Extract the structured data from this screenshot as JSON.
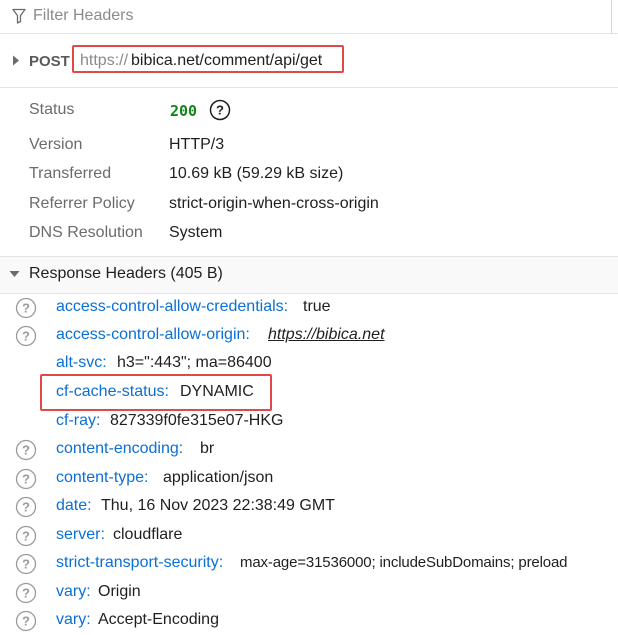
{
  "filter": {
    "placeholder": "Filter Headers"
  },
  "request": {
    "method": "POST",
    "url_scheme": "https://",
    "url_rest": "bibica.net/comment/api/get"
  },
  "summary": {
    "status_label": "Status",
    "status_code": "200",
    "version_label": "Version",
    "version_value": "HTTP/3",
    "transferred_label": "Transferred",
    "transferred_value": "10.69 kB (59.29 kB size)",
    "referrer_label": "Referrer Policy",
    "referrer_value": "strict-origin-when-cross-origin",
    "dns_label": "DNS Resolution",
    "dns_value": "System"
  },
  "response_headers": {
    "title": "Response Headers (405 B)",
    "items": [
      {
        "name": "access-control-allow-credentials:",
        "value": "true"
      },
      {
        "name": "access-control-allow-origin:",
        "value": "https://bibica.net"
      },
      {
        "name": "alt-svc:",
        "value": "h3=\":443\"; ma=86400"
      },
      {
        "name": "cf-cache-status:",
        "value": "DYNAMIC"
      },
      {
        "name": "cf-ray:",
        "value": "827339f0fe315e07-HKG"
      },
      {
        "name": "content-encoding:",
        "value": "br"
      },
      {
        "name": "content-type:",
        "value": "application/json"
      },
      {
        "name": "date:",
        "value": "Thu, 16 Nov 2023 22:38:49 GMT"
      },
      {
        "name": "server:",
        "value": "cloudflare"
      },
      {
        "name": "strict-transport-security:",
        "value": "max-age=31536000; includeSubDomains; preload"
      },
      {
        "name": "vary:",
        "value": "Origin"
      },
      {
        "name": "vary:",
        "value": "Accept-Encoding"
      }
    ]
  },
  "colors": {
    "header_name": "#0a6fd6",
    "status_ok": "#13841a",
    "highlight": "#e0484a"
  },
  "icons": {
    "filter": "funnel-icon",
    "help": "help-circle-icon",
    "expand": "caret-right-icon",
    "collapse": "caret-down-icon"
  }
}
